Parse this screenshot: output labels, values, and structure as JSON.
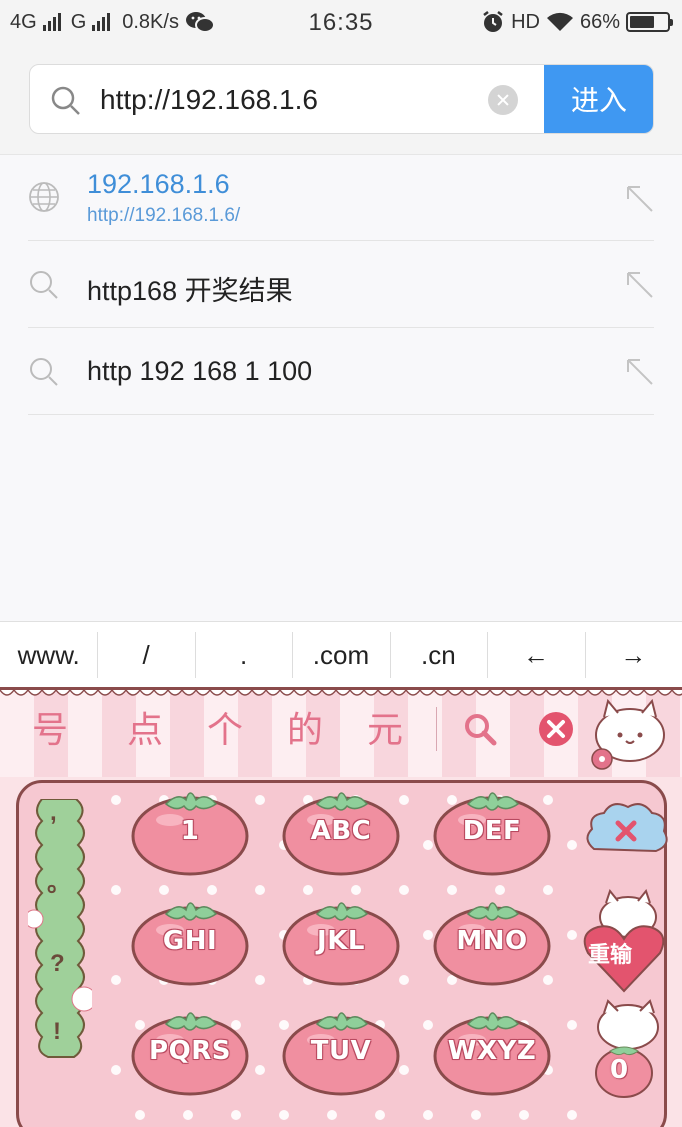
{
  "status_bar": {
    "network1": "4G",
    "network2": "G",
    "speed": "0.8K/s",
    "time": "16:35",
    "hd": "HD",
    "battery": "66%",
    "battery_level": 0.66
  },
  "address_bar": {
    "value": "http://192.168.1.6",
    "go_label": "进入"
  },
  "suggestions": [
    {
      "title": "192.168.1.6",
      "url": "http://192.168.1.6/",
      "icon": "globe-icon"
    },
    {
      "title": "http168 开奖结果",
      "icon": "search-icon"
    },
    {
      "title": "http 192 168 1 100",
      "icon": "search-icon"
    }
  ],
  "shortcut_keys": [
    "www.",
    "/",
    ".",
    ".com",
    ".cn",
    "←",
    "→"
  ],
  "keyboard": {
    "candidates": [
      "号",
      "点",
      "个",
      "的",
      "元"
    ],
    "punct": [
      ",",
      "。",
      "?",
      "!"
    ],
    "keys": [
      [
        "1",
        "ABC",
        "DEF"
      ],
      [
        "GHI",
        "JKL",
        "MNO"
      ],
      [
        "PQRS",
        "TUV",
        "WXYZ"
      ]
    ],
    "reenter_label": "重输",
    "zero_label": "0",
    "theme_colors": {
      "tomato": "#f08fa0",
      "leaf": "#8fcf9a",
      "outline": "#8a4b4b",
      "accent": "#e3738b"
    }
  }
}
